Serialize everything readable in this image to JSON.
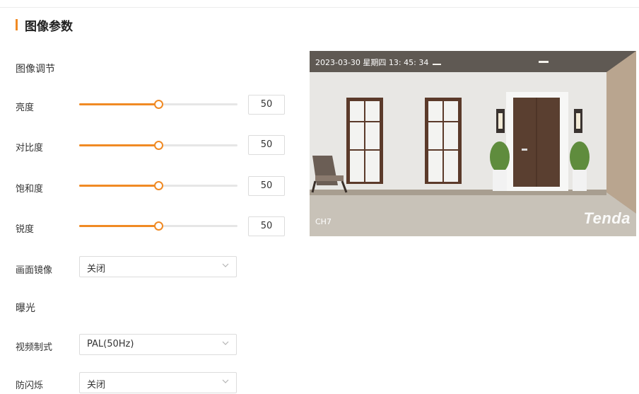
{
  "page": {
    "title": "图像参数",
    "accent_color": "#f08a24"
  },
  "image_adjust": {
    "section_title": "图像调节",
    "sliders": [
      {
        "label": "亮度",
        "value": "50",
        "min": 0,
        "max": 100
      },
      {
        "label": "对比度",
        "value": "50",
        "min": 0,
        "max": 100
      },
      {
        "label": "饱和度",
        "value": "50",
        "min": 0,
        "max": 100
      },
      {
        "label": "锐度",
        "value": "50",
        "min": 0,
        "max": 100
      }
    ],
    "mirror": {
      "label": "画面镜像",
      "value": "关闭"
    }
  },
  "exposure": {
    "section_title": "曝光",
    "video_standard": {
      "label": "视频制式",
      "value": "PAL(50Hz)"
    },
    "anti_flicker": {
      "label": "防闪烁",
      "value": "关闭"
    }
  },
  "preview": {
    "timestamp": "2023-03-30 星期四 13: 45: 34",
    "channel": "CH7",
    "logo": "Tenda"
  }
}
